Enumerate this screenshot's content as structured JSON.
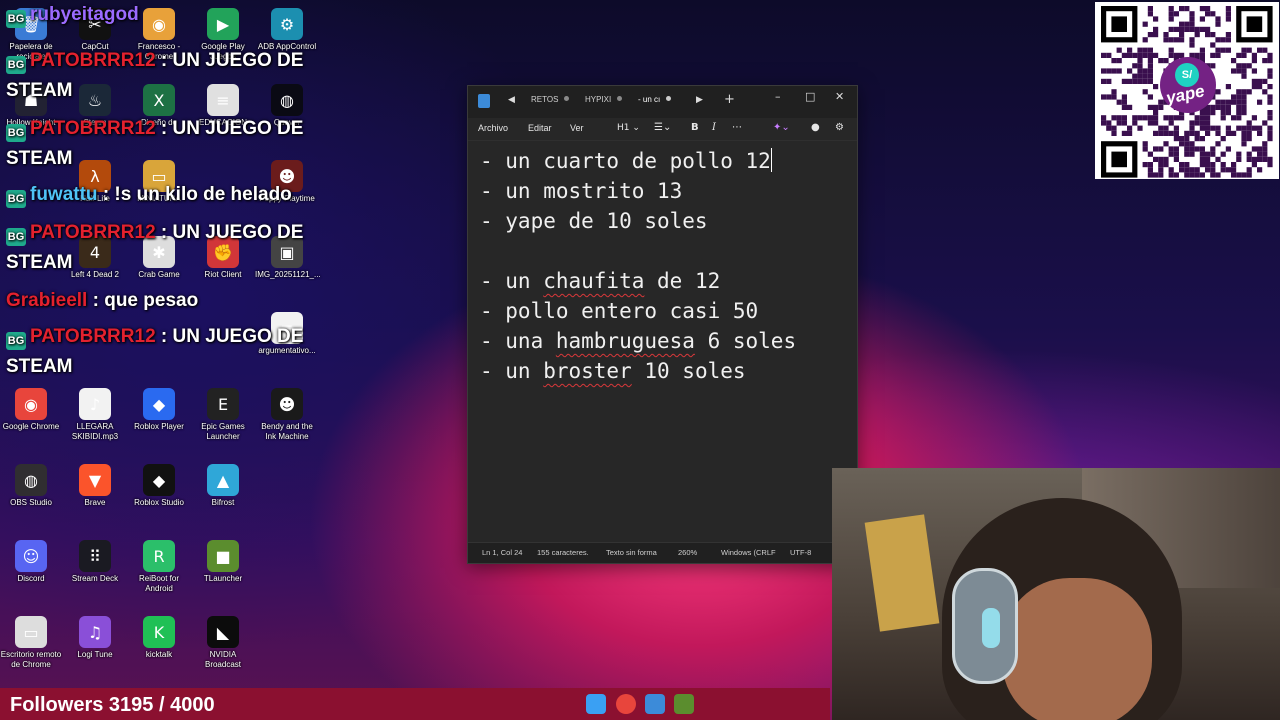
{
  "desktop_icons": [
    {
      "label": "Papelera de reciclaje",
      "icon": "recycle-bin-icon",
      "color": "#3a7bd5",
      "glyph": "🗑"
    },
    {
      "label": "CapCut",
      "icon": "capcut-icon",
      "color": "#111111",
      "glyph": "✂"
    },
    {
      "label": "Francesco - Chrome",
      "icon": "chrome-icon",
      "color": "#e8a13a",
      "glyph": "◉"
    },
    {
      "label": "Google Play Juegos",
      "icon": "google-play-icon",
      "color": "#22a35a",
      "glyph": "▶"
    },
    {
      "label": "ADB AppControl",
      "icon": "adb-icon",
      "color": "#1c8fb0",
      "glyph": "⚙"
    },
    {
      "label": "Hollow Knight",
      "icon": "hollow-knight-icon",
      "color": "#223",
      "glyph": "☗"
    },
    {
      "label": "Steam",
      "icon": "steam-icon",
      "color": "#1b2838",
      "glyph": "♨"
    },
    {
      "label": "Diseño de",
      "icon": "excel-icon",
      "color": "#1d7144",
      "glyph": "X"
    },
    {
      "label": "EDUCACION",
      "icon": "document-icon",
      "color": "#e0e0e0",
      "glyph": "≡"
    },
    {
      "label": "Quaver",
      "icon": "quaver-icon",
      "color": "#0a0a14",
      "glyph": "◍"
    },
    {
      "label": "Half-Life",
      "icon": "half-life-icon",
      "color": "#b34a0c",
      "glyph": "λ"
    },
    {
      "label": "MINIATURA",
      "icon": "folder-icon",
      "color": "#d9a53a",
      "glyph": "▭"
    },
    {
      "label": "Poppy Playtime",
      "icon": "poppy-playtime-icon",
      "color": "#6b1c1c",
      "glyph": "☻"
    },
    {
      "label": "Left 4 Dead 2",
      "icon": "left4dead-icon",
      "color": "#3a2a1a",
      "glyph": "4"
    },
    {
      "label": "Crab Game",
      "icon": "crab-game-icon",
      "color": "#ddd",
      "glyph": "✱"
    },
    {
      "label": "Riot Client",
      "icon": "riot-client-icon",
      "color": "#d13639",
      "glyph": "✊"
    },
    {
      "label": "IMG_20251121_...",
      "icon": "image-file-icon",
      "color": "#444",
      "glyph": "▣"
    },
    {
      "label": "argumentativo...",
      "icon": "word-doc-icon",
      "color": "#f2f2f2",
      "glyph": "≡"
    },
    {
      "label": "Google Chrome",
      "icon": "chrome-icon",
      "color": "#e8453c",
      "glyph": "◉"
    },
    {
      "label": "LLEGARA SKIBIDI.mp3",
      "icon": "audio-file-icon",
      "color": "#f2f2f2",
      "glyph": "♪"
    },
    {
      "label": "Roblox Player",
      "icon": "roblox-player-icon",
      "color": "#2a6af0",
      "glyph": "◆"
    },
    {
      "label": "Epic Games Launcher",
      "icon": "epic-games-icon",
      "color": "#222",
      "glyph": "E"
    },
    {
      "label": "Bendy and the Ink Machine",
      "icon": "bendy-icon",
      "color": "#1a1a1a",
      "glyph": "☻"
    },
    {
      "label": "OBS Studio",
      "icon": "obs-icon",
      "color": "#302e31",
      "glyph": "◍"
    },
    {
      "label": "Brave",
      "icon": "brave-icon",
      "color": "#fb542b",
      "glyph": "▼"
    },
    {
      "label": "Roblox Studio",
      "icon": "roblox-studio-icon",
      "color": "#111",
      "glyph": "◆"
    },
    {
      "label": "Bifrost",
      "icon": "bifrost-icon",
      "color": "#2fa7d8",
      "glyph": "▲"
    },
    {
      "label": "Discord",
      "icon": "discord-icon",
      "color": "#5865f2",
      "glyph": "☺"
    },
    {
      "label": "Stream Deck",
      "icon": "stream-deck-icon",
      "color": "#1a1a22",
      "glyph": "⠿"
    },
    {
      "label": "ReiBoot for Android",
      "icon": "reiboot-icon",
      "color": "#2bbf6a",
      "glyph": "R"
    },
    {
      "label": "TLauncher",
      "icon": "tlauncher-icon",
      "color": "#5b8d2e",
      "glyph": "■"
    },
    {
      "label": "Escritorio remoto de Chrome",
      "icon": "remote-desktop-icon",
      "color": "#ddd",
      "glyph": "▭"
    },
    {
      "label": "Logi Tune",
      "icon": "logi-tune-icon",
      "color": "#8a4fd8",
      "glyph": "♫"
    },
    {
      "label": "kicktalk",
      "icon": "kicktalk-icon",
      "color": "#20c055",
      "glyph": "K"
    },
    {
      "label": "NVIDIA Broadcast",
      "icon": "nvidia-icon",
      "color": "#0c0c0c",
      "glyph": "◣"
    }
  ],
  "chat": [
    {
      "user": "rubyeitagod",
      "message": "",
      "user_color": "#9b6bff"
    },
    {
      "user": "PATOBRRR12",
      "message": ": UN JUEGO DE",
      "user_color": "#e3212e"
    },
    {
      "user": "",
      "message": "STEAM",
      "user_color": "#ffffff"
    },
    {
      "user": "PATOBRRR12",
      "message": ": UN JUEGO DE",
      "user_color": "#e3212e"
    },
    {
      "user": "",
      "message": "STEAM",
      "user_color": "#ffffff"
    },
    {
      "user": "fuwattu",
      "message": ": !s un kilo de helado",
      "user_color": "#4fc3f7"
    },
    {
      "user": "PATOBRRR12",
      "message": ": UN JUEGO DE",
      "user_color": "#e3212e"
    },
    {
      "user": "",
      "message": "STEAM",
      "user_color": "#ffffff"
    },
    {
      "user": "Grabieell",
      "message": ": que pesao",
      "user_color": "#e3212e"
    },
    {
      "user": "PATOBRRR12",
      "message": ": UN JUEGO DE",
      "user_color": "#e3212e"
    },
    {
      "user": "",
      "message": "STEAM",
      "user_color": "#ffffff"
    }
  ],
  "notepad": {
    "tabs": [
      {
        "label": "RETOS"
      },
      {
        "label": "HYPIXI"
      },
      {
        "label": "- un cı"
      }
    ],
    "menu": [
      "Archivo",
      "Editar",
      "Ver"
    ],
    "heading_selector": "H1",
    "lines": [
      "- un cuarto de pollo 12",
      "- un mostrito 13",
      "- yape de 10 soles",
      "",
      "- un chaufita de 12",
      "- pollo entero casi 50",
      "- una hambruguesa 6 soles",
      "- un broster 10 soles"
    ],
    "status": {
      "position": "Ln 1, Col 24",
      "chars": "155 caracteres.",
      "format": "Texto sin forma",
      "zoom": "260%",
      "line_ending": "Windows (CRLF",
      "encoding": "UTF-8"
    }
  },
  "qr": {
    "brand": "yape",
    "color": "#742284"
  },
  "followers": {
    "label": "Followers 3195 / 4000"
  }
}
